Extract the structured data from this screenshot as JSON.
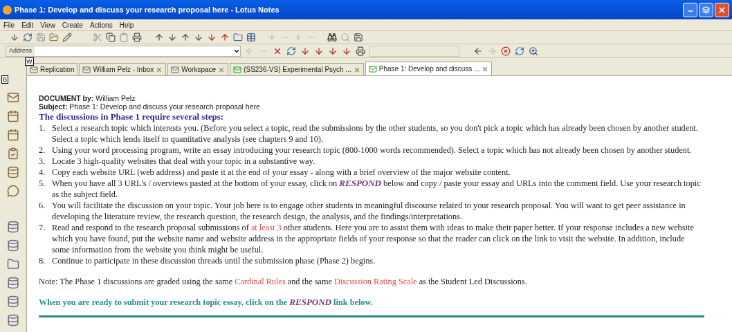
{
  "window": {
    "title": "Phase 1: Develop and discuss your research proposal here - Lotus Notes"
  },
  "menu": [
    "File",
    "Edit",
    "View",
    "Create",
    "Actions",
    "Help"
  ],
  "address": {
    "label": "Address"
  },
  "tab_hint": "W",
  "sidebar_hint": "B",
  "tabs": [
    {
      "label": "Replication",
      "selected": false,
      "closable": false
    },
    {
      "label": "William Pelz - Inbox",
      "selected": false,
      "closable": true
    },
    {
      "label": "Workspace",
      "selected": false,
      "closable": true
    },
    {
      "label": "(SS236-VS) Experimental Psych ...",
      "selected": false,
      "closable": true
    },
    {
      "label": "Phase 1: Develop and discuss ...",
      "selected": true,
      "closable": true
    }
  ],
  "document": {
    "author_label": "DOCUMENT by:",
    "author": "William Pelz",
    "subject_label": "Subject:",
    "subject": "Phase 1: Develop and discuss your research proposal here",
    "heading": "The discussions in Phase 1 require several steps:",
    "steps": [
      {
        "number": "1.",
        "parts": [
          {
            "kind": "text",
            "text": "Select a research topic which interests you. (Before you select a topic, read the submissions by the other students, so you don't pick a topic which has already been chosen by another student. Select a topic which lends itself to quantitative analysis (see chapters 9 and 10)."
          }
        ]
      },
      {
        "number": "2.",
        "parts": [
          {
            "kind": "text",
            "text": "Using your word processing program, write an essay introducing your research topic (800-1000 words recommended). Select a topic which has not already been chosen by another student."
          }
        ]
      },
      {
        "number": "3.",
        "parts": [
          {
            "kind": "text",
            "text": "Locate 3 high-quality websites that deal with your topic in a substantive way."
          }
        ]
      },
      {
        "number": "4.",
        "parts": [
          {
            "kind": "text",
            "text": "Copy each website URL (web address) and paste it at the end of your essay - along with a brief overview of the major website content."
          }
        ]
      },
      {
        "number": "5.",
        "parts": [
          {
            "kind": "text",
            "text": "When you have all 3 URL's / overviews pasted at the bottom of your essay, click on "
          },
          {
            "kind": "respond",
            "text": "RESPOND"
          },
          {
            "kind": "text",
            "text": "  below and copy / paste your essay and URLs into the comment field.  Use your research topic as the subject field."
          }
        ]
      },
      {
        "number": "6.",
        "parts": [
          {
            "kind": "text",
            "text": "You will facilitate the discussion on your topic.  Your job here is to engage other students in meaningful discourse related to your research proposal.  You will want to get peer assistance in developing the literature review, the research question, the research design, the analysis, and the findings/interpretations."
          }
        ]
      },
      {
        "number": "7.",
        "parts": [
          {
            "kind": "text",
            "text": "Read and respond to the research proposal submissions of "
          },
          {
            "kind": "red",
            "text": "at least 3"
          },
          {
            "kind": "text",
            "text": " other students.  Here you are to assist them with ideas to make their paper better.  If your response includes a new website which you have found, put the website name and website address in the appropriate fields of your response so that the reader can click on the link to visit the website. In addition, include some information from the website you think might be useful."
          }
        ]
      },
      {
        "number": "8.",
        "parts": [
          {
            "kind": "text",
            "text": "Continue to participate in these discussion threads until the submission phase (Phase 2) begins."
          }
        ]
      }
    ],
    "note": [
      {
        "kind": "text",
        "text": "Note: The Phase 1 discussions are graded using the same "
      },
      {
        "kind": "red",
        "text": "Cardinal Rules"
      },
      {
        "kind": "text",
        "text": " and the same "
      },
      {
        "kind": "red",
        "text": "Discussion Rating Scale"
      },
      {
        "kind": "text",
        "text": " as the Student Led Discussions."
      }
    ],
    "closing": [
      {
        "kind": "text",
        "text": "When you are ready to submit your research topic essay, click on the "
      },
      {
        "kind": "respond",
        "text": "RESPOND"
      },
      {
        "kind": "text",
        "text": "  link below."
      }
    ]
  }
}
